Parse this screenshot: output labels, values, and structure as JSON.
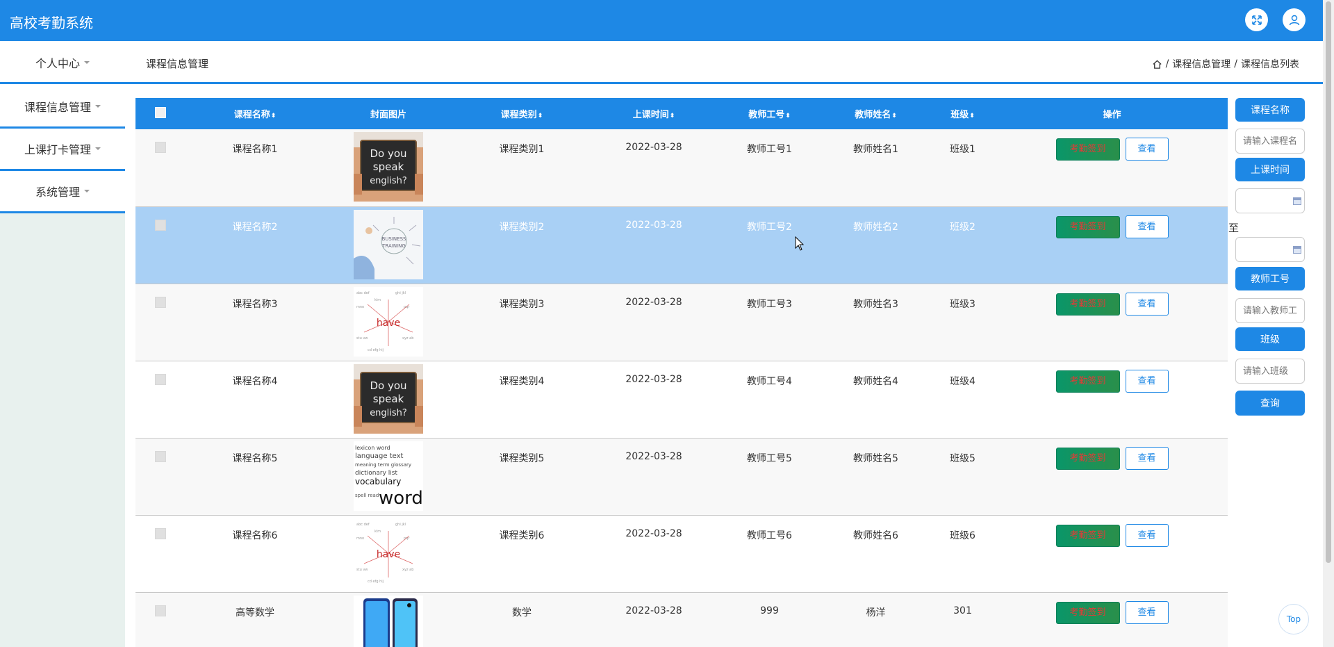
{
  "app": {
    "title": "高校考勤系统"
  },
  "header": {
    "fullscreen_icon": "fullscreen-icon",
    "user_icon": "user-icon"
  },
  "topnav": {
    "personal_center": "个人中心"
  },
  "page": {
    "title": "课程信息管理",
    "breadcrumb": [
      "课程信息管理",
      "课程信息列表"
    ]
  },
  "sidebar": {
    "items": [
      "课程信息管理",
      "上课打卡管理",
      "系统管理"
    ]
  },
  "table": {
    "headers": {
      "name": "课程名称",
      "cover": "封面图片",
      "type": "课程类别",
      "time": "上课时间",
      "teacher_id": "教师工号",
      "teacher_name": "教师姓名",
      "class": "班级",
      "ops": "操作"
    },
    "sort_glyph": "⬍",
    "actions": {
      "sign": "考勤签到",
      "view": "查看"
    },
    "rows": [
      {
        "name": "课程名称1",
        "type": "课程类别1",
        "time": "2022-03-28",
        "teacher_id": "教师工号1",
        "teacher_name": "教师姓名1",
        "class": "班级1",
        "cover": "do-you-speak-english"
      },
      {
        "name": "课程名称2",
        "type": "课程类别2",
        "time": "2022-03-28",
        "teacher_id": "教师工号2",
        "teacher_name": "教师姓名2",
        "class": "班级2",
        "cover": "business-training"
      },
      {
        "name": "课程名称3",
        "type": "课程类别3",
        "time": "2022-03-28",
        "teacher_id": "教师工号3",
        "teacher_name": "教师姓名3",
        "class": "班级3",
        "cover": "have-mindmap"
      },
      {
        "name": "课程名称4",
        "type": "课程类别4",
        "time": "2022-03-28",
        "teacher_id": "教师工号4",
        "teacher_name": "教师姓名4",
        "class": "班级4",
        "cover": "do-you-speak-english"
      },
      {
        "name": "课程名称5",
        "type": "课程类别5",
        "time": "2022-03-28",
        "teacher_id": "教师工号5",
        "teacher_name": "教师姓名5",
        "class": "班级5",
        "cover": "vocabulary-words"
      },
      {
        "name": "课程名称6",
        "type": "课程类别6",
        "time": "2022-03-28",
        "teacher_id": "教师工号6",
        "teacher_name": "教师姓名6",
        "class": "班级6",
        "cover": "have-mindmap"
      },
      {
        "name": "高等数学",
        "type": "数学",
        "time": "2022-03-28",
        "teacher_id": "999",
        "teacher_name": "杨洋",
        "class": "301",
        "cover": "smartphone"
      }
    ]
  },
  "search": {
    "course_name_label": "课程名称",
    "course_name_placeholder": "请输入课程名称",
    "time_label": "上课时间",
    "to_label": "至",
    "teacher_id_label": "教师工号",
    "teacher_id_placeholder": "请输入教师工号",
    "class_label": "班级",
    "class_placeholder": "请输入班级",
    "query_button": "查询"
  },
  "misc": {
    "top_button": "Top"
  },
  "colors": {
    "primary": "#1e88e5",
    "selected_row": "#a9d0f5",
    "sign_button": "#0a9669",
    "sign_text": "#e53935"
  }
}
